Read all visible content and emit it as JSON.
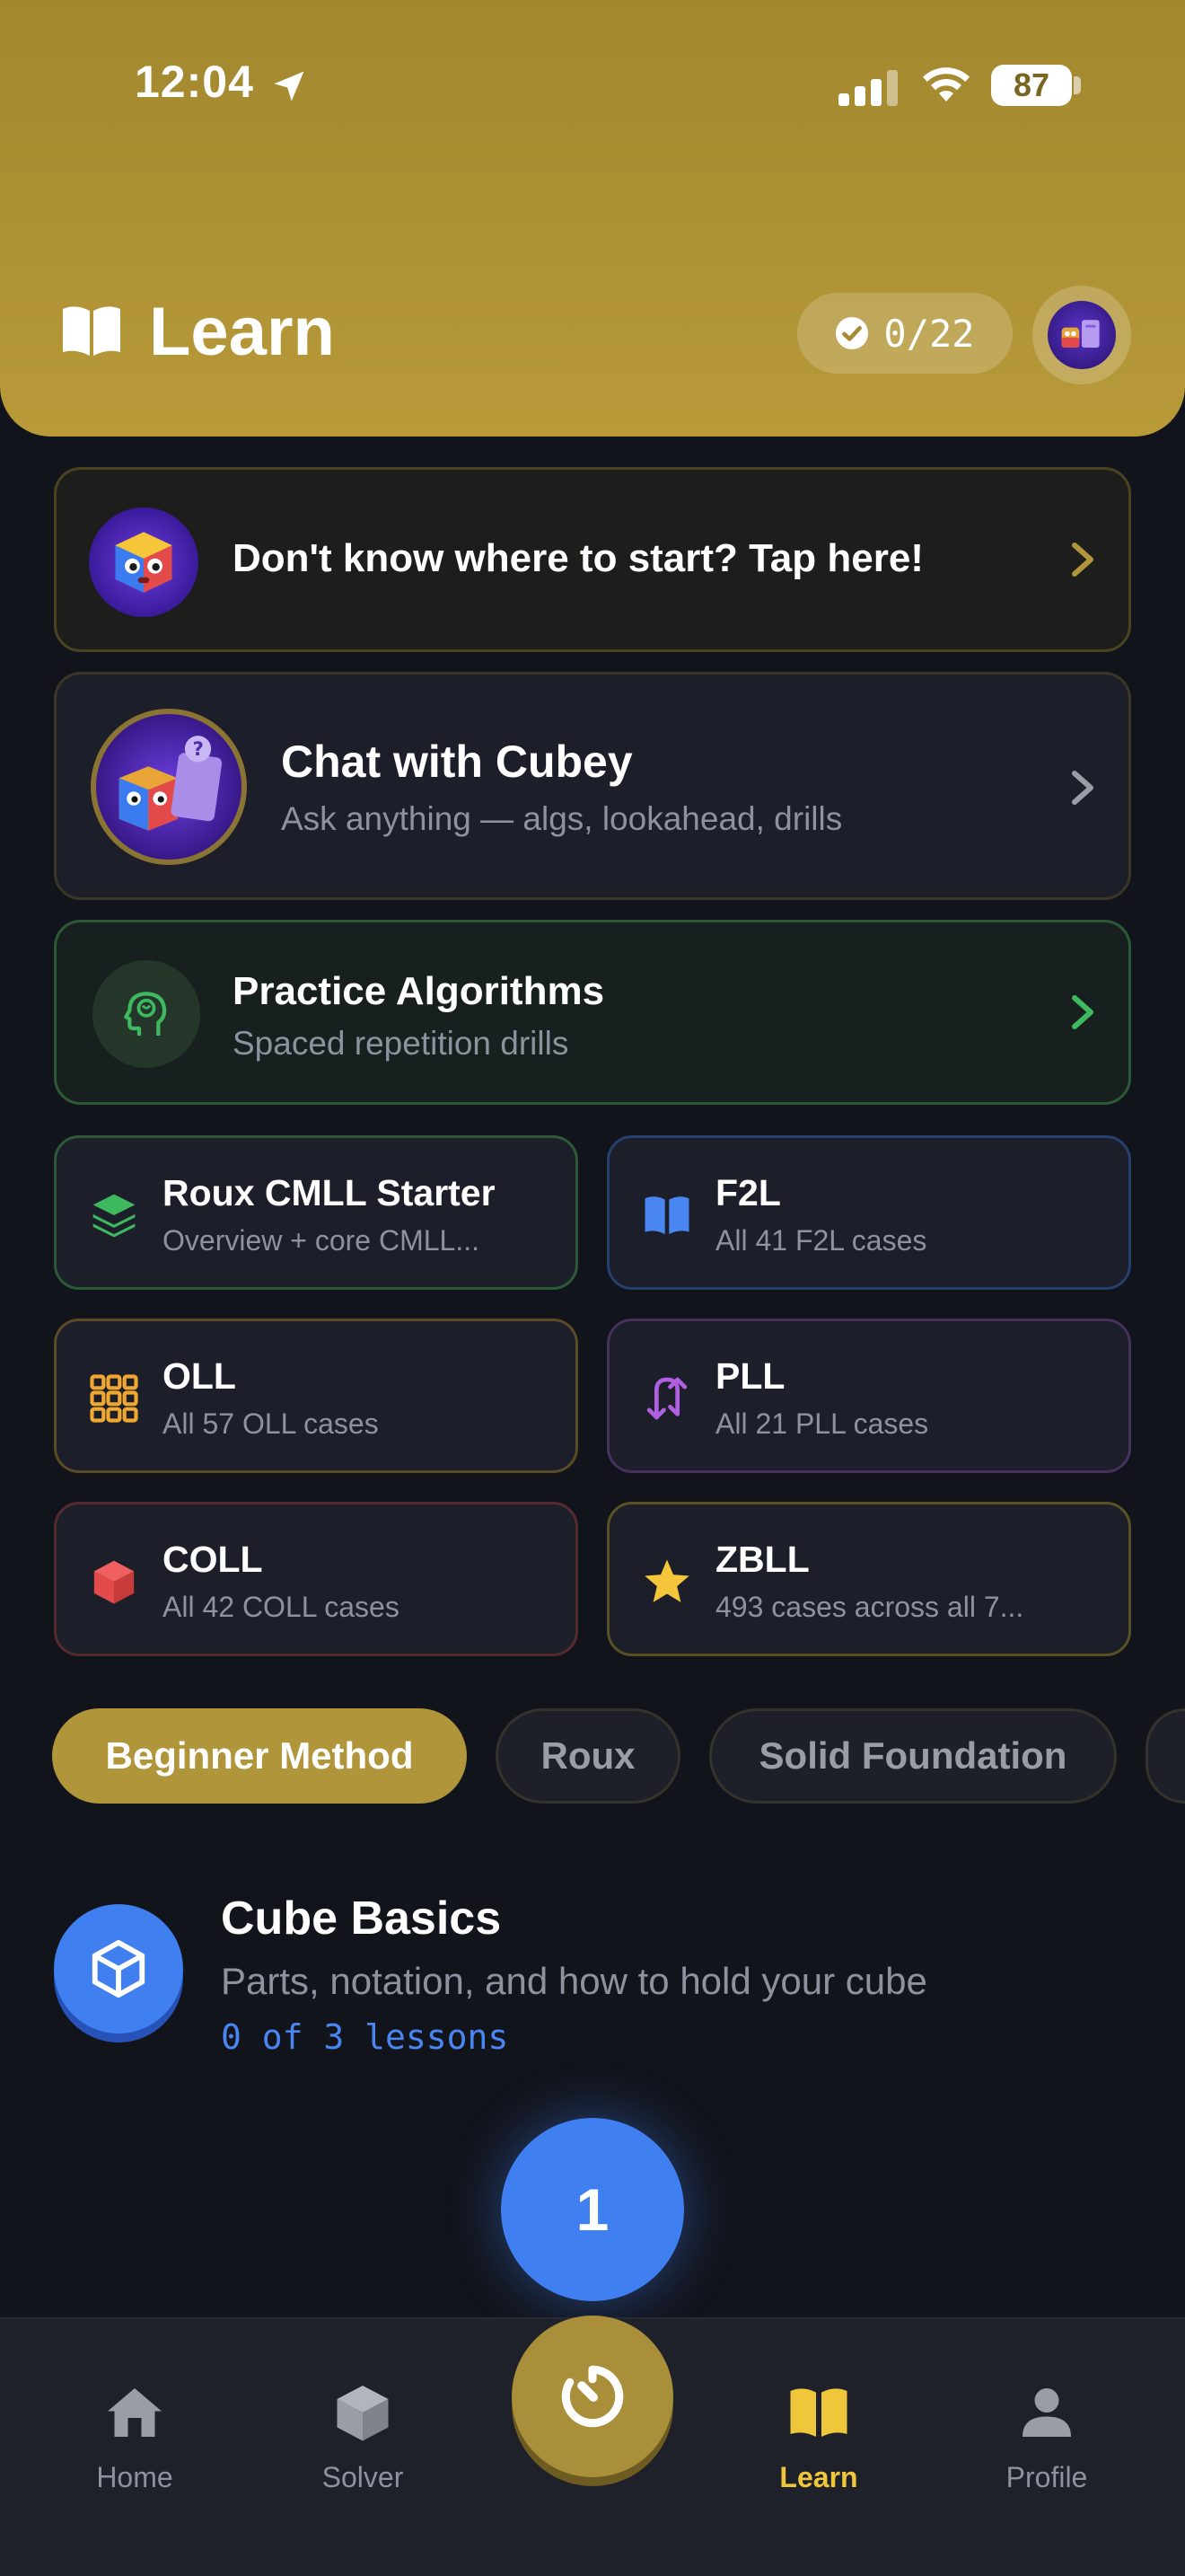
{
  "status_bar": {
    "time": "12:04",
    "battery": "87"
  },
  "header": {
    "title": "Learn",
    "progress": "0/22"
  },
  "start_card": {
    "title": "Don't know where to start? Tap here!"
  },
  "chat_card": {
    "title": "Chat with Cubey",
    "subtitle": "Ask anything — algs, lookahead, drills"
  },
  "practice_card": {
    "title": "Practice Algorithms",
    "subtitle": "Spaced repetition drills"
  },
  "tiles": [
    {
      "title": "Roux CMLL Starter",
      "subtitle": "Overview + core CMLL...",
      "icon": "layers-icon",
      "color": "#3fb960"
    },
    {
      "title": "F2L",
      "subtitle": "All 41 F2L cases",
      "icon": "book-icon",
      "color": "#4a86f2"
    },
    {
      "title": "OLL",
      "subtitle": "All 57 OLL cases",
      "icon": "grid-icon",
      "color": "#f0a830"
    },
    {
      "title": "PLL",
      "subtitle": "All 21 PLL cases",
      "icon": "swap-arrows-icon",
      "color": "#b05fe0"
    },
    {
      "title": "COLL",
      "subtitle": "All 42 COLL cases",
      "icon": "cube-icon",
      "color": "#e34b4b"
    },
    {
      "title": "ZBLL",
      "subtitle": "493 cases across all 7...",
      "icon": "star-icon",
      "color": "#f5c63a"
    }
  ],
  "chips": [
    {
      "label": "Beginner Method",
      "active": true
    },
    {
      "label": "Roux",
      "active": false
    },
    {
      "label": "Solid Foundation",
      "active": false
    }
  ],
  "section": {
    "title": "Cube Basics",
    "subtitle": "Parts, notation, and how to hold your cube",
    "progress": "0 of 3 lessons"
  },
  "lesson_node": {
    "number": "1"
  },
  "tabbar": {
    "home": "Home",
    "solver": "Solver",
    "learn": "Learn",
    "profile": "Profile",
    "active": "learn"
  },
  "colors": {
    "accent_gold": "#b0953a",
    "active_tab": "#f0c63a",
    "lesson_blue": "#3f7ff0",
    "background": "#12141c"
  }
}
